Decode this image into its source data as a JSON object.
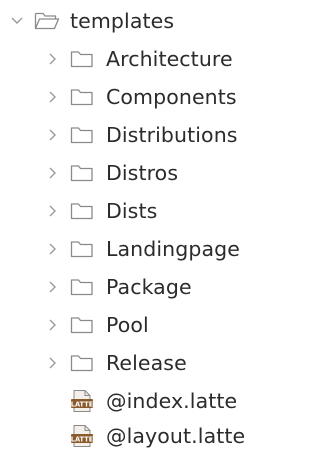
{
  "root": {
    "label": "templates",
    "expanded": true,
    "icon": "folder-open-icon",
    "chevron": "chevron-down-icon"
  },
  "folders": [
    {
      "label": "Architecture",
      "icon": "folder-icon",
      "chevron": "chevron-right-icon"
    },
    {
      "label": "Components",
      "icon": "folder-icon",
      "chevron": "chevron-right-icon"
    },
    {
      "label": "Distributions",
      "icon": "folder-icon",
      "chevron": "chevron-right-icon"
    },
    {
      "label": "Distros",
      "icon": "folder-icon",
      "chevron": "chevron-right-icon"
    },
    {
      "label": "Dists",
      "icon": "folder-icon",
      "chevron": "chevron-right-icon"
    },
    {
      "label": "Landingpage",
      "icon": "folder-icon",
      "chevron": "chevron-right-icon"
    },
    {
      "label": "Package",
      "icon": "folder-icon",
      "chevron": "chevron-right-icon"
    },
    {
      "label": "Pool",
      "icon": "folder-icon",
      "chevron": "chevron-right-icon"
    },
    {
      "label": "Release",
      "icon": "folder-icon",
      "chevron": "chevron-right-icon"
    }
  ],
  "files": [
    {
      "label": "@index.latte",
      "icon": "latte-file-icon",
      "icon_text": "LATTE"
    },
    {
      "label": "@layout.latte",
      "icon": "latte-file-icon",
      "icon_text": "LATTE"
    }
  ],
  "colors": {
    "chevron": "#9a9a9a",
    "folder_stroke": "#8a8a8a",
    "text": "#2b2b2b",
    "latte_brown": "#8a5a2b",
    "latte_text": "#ffffff"
  }
}
